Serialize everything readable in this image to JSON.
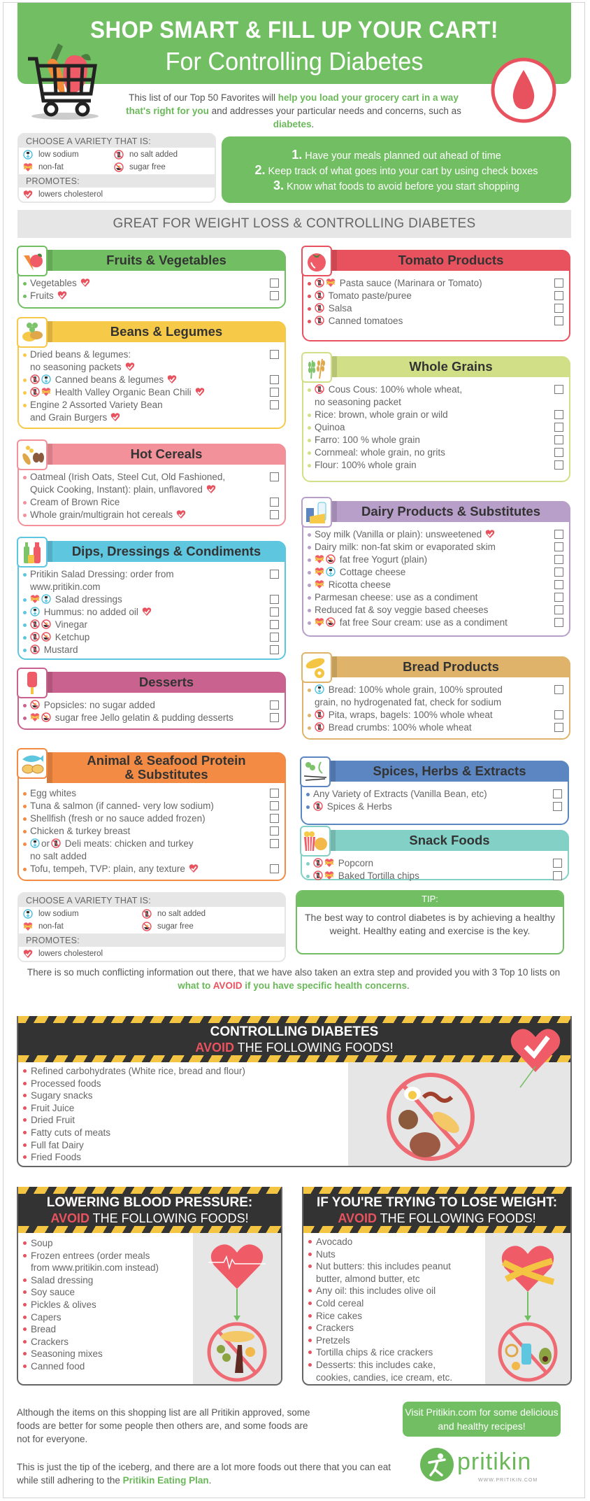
{
  "header": {
    "title": "SHOP SMART & FILL UP YOUR CART!",
    "subtitle": "For Controlling Diabetes",
    "intro_pre": "This list of our Top 50 Favorites will ",
    "intro_bold1": "help you load your grocery cart in a way that's right for you",
    "intro_mid": " and addresses your particular needs and concerns, such as ",
    "intro_bold2": "diabetes",
    "intro_end": "."
  },
  "legend": {
    "choose_label": "CHOOSE A VARIETY THAT IS:",
    "low_sodium": "low sodium",
    "no_salt_added": "no salt added",
    "non_fat": "non-fat",
    "sugar_free": "sugar free",
    "promotes_label": "PROMOTES:",
    "lowers_cholesterol": "lowers cholesterol"
  },
  "tips": [
    {
      "num": "1.",
      "text": " Have your meals planned out ahead of time"
    },
    {
      "num": "2.",
      "text": " Keep track of what goes into your cart by using check boxes"
    },
    {
      "num": "3.",
      "text": " Know what foods to avoid before you start shopping"
    }
  ],
  "band_title": "GREAT FOR WEIGHT LOSS & CONTROLLING DIABETES",
  "colors": {
    "green": "#72bf63",
    "red": "#e8525e",
    "yellow": "#f7c948",
    "pink": "#f3919a",
    "blue": "#5fc6e0",
    "magenta": "#c9628f",
    "orange": "#f48b45",
    "lime": "#d1e087",
    "purple": "#b89fca",
    "tan": "#dfb46a",
    "steel": "#5b86c2",
    "teal": "#83d0c6"
  },
  "categories": {
    "fruits": {
      "title": "Fruits & Vegetables",
      "items": [
        {
          "text": "Vegetables",
          "icons": [],
          "heart": true
        },
        {
          "text": "Fruits",
          "icons": [],
          "heart": true
        }
      ]
    },
    "beans": {
      "title": "Beans & Legumes",
      "items": [
        {
          "text": "Dried beans & legumes:",
          "text2": "no seasoning packets",
          "icons": [],
          "heart": true
        },
        {
          "text": "Canned beans & legumes",
          "icons": [
            "no-salt",
            "low-sodium"
          ],
          "heart": true
        },
        {
          "text": "Health Valley Organic Bean Chili",
          "icons": [
            "no-salt",
            "non-fat"
          ],
          "heart": true
        },
        {
          "text": "Engine 2 Assorted Variety Bean",
          "text2": "and Grain Burgers",
          "icons": [],
          "heart": true
        }
      ]
    },
    "cereals": {
      "title": "Hot Cereals",
      "items": [
        {
          "text": "Oatmeal (Irish Oats, Steel Cut, Old Fashioned,",
          "text2": "Quick Cooking, Instant): plain, unflavored",
          "icons": [],
          "heart": true
        },
        {
          "text": "Cream of Brown Rice",
          "icons": [],
          "heart": false
        },
        {
          "text": "Whole grain/multigrain hot cereals",
          "icons": [],
          "heart": true
        }
      ]
    },
    "dips": {
      "title": "Dips, Dressings & Condiments",
      "items": [
        {
          "text": "Pritikin Salad Dressing: order from",
          "text2": "www.pritikin.com",
          "icons": [],
          "heart": false
        },
        {
          "text": "Salad dressings",
          "icons": [
            "non-fat",
            "low-sodium"
          ],
          "heart": false
        },
        {
          "text": "Hummus: no added oil",
          "icons": [
            "low-sodium"
          ],
          "heart": true
        },
        {
          "text": "Vinegar",
          "icons": [
            "no-salt",
            "sugar-free"
          ],
          "heart": false
        },
        {
          "text": "Ketchup",
          "icons": [
            "no-salt",
            "sugar-free"
          ],
          "heart": false
        },
        {
          "text": "Mustard",
          "icons": [
            "no-salt"
          ],
          "heart": false
        }
      ]
    },
    "desserts": {
      "title": "Desserts",
      "items": [
        {
          "text": "Popsicles: no sugar added",
          "icons": [
            "sugar-free"
          ],
          "heart": false
        },
        {
          "text": "sugar free Jello gelatin & pudding desserts",
          "icons": [
            "non-fat",
            "sugar-free"
          ],
          "heart": false
        }
      ]
    },
    "protein": {
      "title": "Animal & Seafood Protein",
      "title2": "& Substitutes",
      "items": [
        {
          "text": "Egg whites",
          "icons": [],
          "heart": false
        },
        {
          "text": "Tuna & salmon (if canned- very low sodium)",
          "icons": [],
          "heart": false
        },
        {
          "text": "Shellfish (fresh or no sauce added frozen)",
          "icons": [],
          "heart": false
        },
        {
          "text": "Chicken & turkey breast",
          "icons": [],
          "heart": false
        },
        {
          "text": "Deli meats: chicken and turkey",
          "text2": "no salt added",
          "icons": [
            "low-sodium",
            "or",
            "no-salt"
          ],
          "heart": false
        },
        {
          "text": "Tofu, tempeh, TVP: plain, any texture",
          "icons": [],
          "heart": true
        }
      ]
    },
    "tomato": {
      "title": "Tomato Products",
      "items": [
        {
          "text": "Pasta sauce (Marinara or Tomato)",
          "icons": [
            "no-salt",
            "non-fat"
          ],
          "heart": false
        },
        {
          "text": "Tomato paste/puree",
          "icons": [
            "no-salt"
          ],
          "heart": false
        },
        {
          "text": "Salsa",
          "icons": [
            "no-salt"
          ],
          "heart": false
        },
        {
          "text": "Canned tomatoes",
          "icons": [
            "no-salt"
          ],
          "heart": false
        }
      ]
    },
    "grains": {
      "title": "Whole Grains",
      "items": [
        {
          "text": "Cous Cous: 100% whole wheat,",
          "text2": "no seasoning packet",
          "icons": [
            "no-salt"
          ],
          "heart": false
        },
        {
          "text": "Rice: brown, whole grain or wild",
          "icons": [],
          "heart": false
        },
        {
          "text": "Quinoa",
          "icons": [],
          "heart": false
        },
        {
          "text": "Farro: 100 % whole grain",
          "icons": [],
          "heart": false
        },
        {
          "text": "Cornmeal: whole grain, no grits",
          "icons": [],
          "heart": false
        },
        {
          "text": "Flour: 100% whole grain",
          "icons": [],
          "heart": false
        }
      ]
    },
    "dairy": {
      "title": "Dairy Products & Substitutes",
      "items": [
        {
          "text": "Soy milk (Vanilla or plain): unsweetened",
          "icons": [],
          "heart": true
        },
        {
          "text": "Dairy milk: non-fat skim or evaporated skim",
          "icons": [],
          "heart": false
        },
        {
          "text": "fat free Yogurt (plain)",
          "icons": [
            "non-fat",
            "sugar-free"
          ],
          "heart": false
        },
        {
          "text": "Cottage cheese",
          "icons": [
            "non-fat",
            "low-sodium"
          ],
          "heart": false
        },
        {
          "text": "Ricotta cheese",
          "icons": [
            "non-fat"
          ],
          "heart": false
        },
        {
          "text": "Parmesan cheese: use as a condiment",
          "icons": [],
          "heart": false
        },
        {
          "text": "Reduced fat & soy veggie based cheeses",
          "icons": [],
          "heart": false
        },
        {
          "text": "fat free Sour cream: use as a condiment",
          "icons": [
            "non-fat",
            "sugar-free"
          ],
          "heart": false
        }
      ]
    },
    "bread": {
      "title": "Bread Products",
      "items": [
        {
          "text": "Bread: 100% whole grain, 100% sprouted",
          "text2": "grain, no hydrogenated fat, check for sodium",
          "icons": [
            "low-sodium"
          ],
          "heart": false
        },
        {
          "text": "Pita, wraps, bagels: 100% whole wheat",
          "icons": [
            "no-salt"
          ],
          "heart": false
        },
        {
          "text": "Bread crumbs: 100% whole wheat",
          "icons": [
            "no-salt"
          ],
          "heart": false
        }
      ]
    },
    "spices": {
      "title": "Spices, Herbs & Extracts",
      "items": [
        {
          "text": "Any Variety of Extracts (Vanilla Bean, etc)",
          "icons": [],
          "heart": false
        },
        {
          "text": "Spices & Herbs",
          "icons": [
            "no-salt"
          ],
          "heart": false
        }
      ]
    },
    "snacks": {
      "title": "Snack Foods",
      "items": [
        {
          "text": "Popcorn",
          "icons": [
            "no-salt",
            "non-fat"
          ],
          "heart": false
        },
        {
          "text": "Baked Tortilla chips",
          "icons": [
            "no-salt",
            "non-fat"
          ],
          "heart": false
        }
      ]
    }
  },
  "tip": {
    "label": "TIP:",
    "text": "The best way to control diabetes is by achieving a healthy weight. Healthy eating and exercise is the key."
  },
  "mid_text": {
    "pre": "There is so much conflicting information out there, that we have also taken an extra step and provided you with 3 Top 10 lists on ",
    "g1": "what to ",
    "r": "AVOID",
    "g2": " if you have specific health concerns",
    "end": "."
  },
  "avoid_lists": {
    "diabetes": {
      "title": "CONTROLLING DIABETES",
      "avoid_word": "AVOID",
      "avoid_rest": " THE FOLLOWING FOODS!",
      "items": [
        "Refined carbohydrates (White rice, bread and flour)",
        "Processed foods",
        "Sugary snacks",
        "Fruit Juice",
        "Dried Fruit",
        "Fatty cuts of meats",
        "Full fat Dairy",
        "Fried Foods"
      ]
    },
    "blood_pressure": {
      "title": "LOWERING BLOOD PRESSURE:",
      "avoid_word": "AVOID",
      "avoid_rest": " THE FOLLOWING FOODS!",
      "items": [
        "Soup",
        "Frozen entrees (order meals\nfrom www.pritikin.com instead)",
        "Salad dressing",
        "Soy sauce",
        "Pickles & olives",
        "Capers",
        "Bread",
        "Crackers",
        "Seasoning mixes",
        "Canned food"
      ]
    },
    "weight": {
      "title": "IF YOU'RE TRYING TO LOSE WEIGHT:",
      "avoid_word": "AVOID",
      "avoid_rest": " THE FOLLOWING FOODS!",
      "items": [
        "Avocado",
        "Nuts",
        "Nut butters: this includes peanut\nbutter, almond butter, etc",
        "Any oil: this includes olive oil",
        "Cold cereal",
        "Rice cakes",
        "Crackers",
        "Pretzels",
        "Tortilla chips & rice crackers",
        "Desserts: this includes cake,\ncookies, candies, ice cream, etc."
      ]
    }
  },
  "footer": {
    "note1": "Although the items on this shopping list are all Pritikin approved, some foods are better for some people then others are, and some foods are not for everyone.",
    "note2_pre": "This is just the tip of the iceberg, and there are a lot more foods out there that you can eat while still adhering to the ",
    "note2_bold": "Pritikin Eating Plan",
    "note2_end": ".",
    "visit_button": "Visit Pritikin.com for some delicious and healthy recipes!",
    "logo_word": "pritikin",
    "logo_url": "WWW.PRITIKIN.COM"
  }
}
